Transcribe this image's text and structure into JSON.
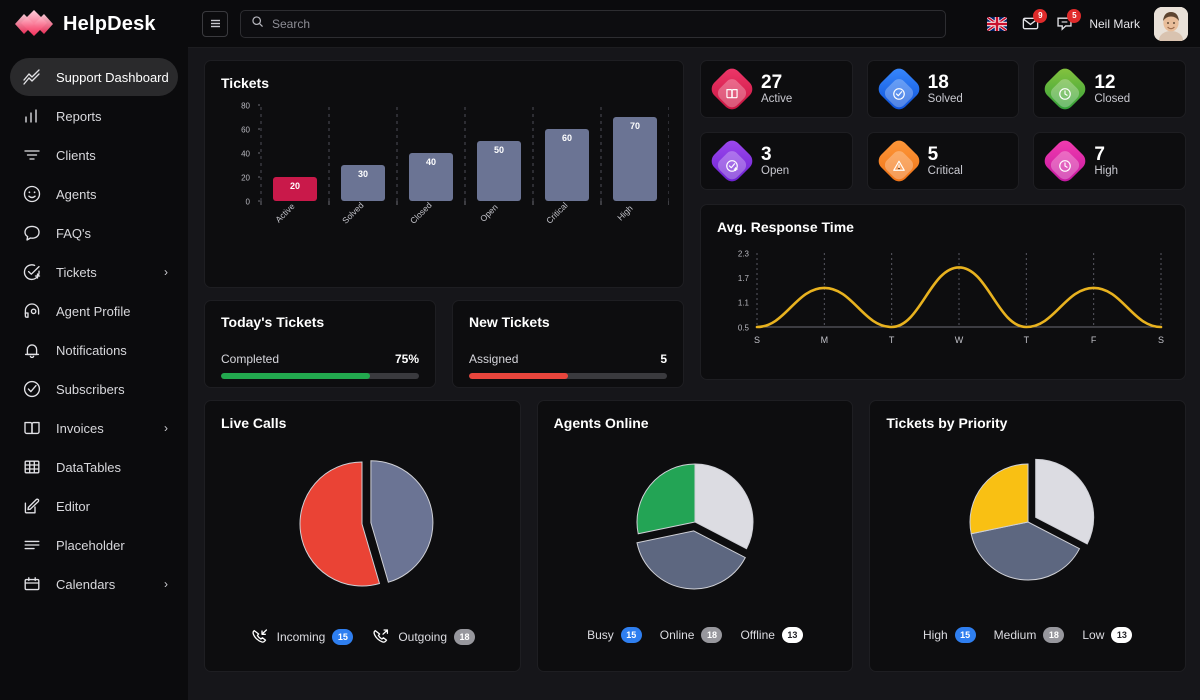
{
  "brand": {
    "name": "HelpDesk",
    "logo_icon": "diamond-cluster-logo"
  },
  "sidebar": {
    "items": [
      {
        "label": "Support Dashboard",
        "icon": "activity-chart-icon",
        "active": true,
        "caret": ""
      },
      {
        "label": "Reports",
        "icon": "bar-chart-icon",
        "active": false,
        "caret": ""
      },
      {
        "label": "Clients",
        "icon": "filter-icon",
        "active": false,
        "caret": ""
      },
      {
        "label": "Agents",
        "icon": "smiley-icon",
        "active": false,
        "caret": ""
      },
      {
        "label": "FAQ's",
        "icon": "chat-bubble-icon",
        "active": false,
        "caret": ""
      },
      {
        "label": "Tickets",
        "icon": "check-circle-plus-icon",
        "active": false,
        "caret": "›"
      },
      {
        "label": "Agent Profile",
        "icon": "headset-user-icon",
        "active": false,
        "caret": ""
      },
      {
        "label": "Notifications",
        "icon": "bell-icon",
        "active": false,
        "caret": ""
      },
      {
        "label": "Subscribers",
        "icon": "check-circle-icon",
        "active": false,
        "caret": ""
      },
      {
        "label": "Invoices",
        "icon": "book-icon",
        "active": false,
        "caret": "›"
      },
      {
        "label": "DataTables",
        "icon": "table-grid-icon",
        "active": false,
        "caret": ""
      },
      {
        "label": "Editor",
        "icon": "pencil-square-icon",
        "active": false,
        "caret": ""
      },
      {
        "label": "Placeholder",
        "icon": "lines-icon",
        "active": false,
        "caret": ""
      },
      {
        "label": "Calendars",
        "icon": "calendar-icon",
        "active": false,
        "caret": "›"
      }
    ]
  },
  "topbar": {
    "menu_icon": "hamburger-icon",
    "search": {
      "placeholder": "Search",
      "value": "",
      "icon": "search-icon"
    },
    "flag_icon": "uk-flag-icon",
    "mail": {
      "icon": "mail-icon",
      "badge": "9"
    },
    "chat": {
      "icon": "chat-icon",
      "badge": "5"
    },
    "user": {
      "name": "Neil Mark",
      "avatar_icon": "user-avatar"
    }
  },
  "tickets_card": {
    "title": "Tickets"
  },
  "stats": [
    {
      "value": "27",
      "label": "Active",
      "icon": "book-open-icon",
      "c1": "#f0396c",
      "c2": "#c7143f"
    },
    {
      "value": "18",
      "label": "Solved",
      "icon": "check-circle-icon",
      "c1": "#3a8bff",
      "c2": "#0c4fd6"
    },
    {
      "value": "12",
      "label": "Closed",
      "icon": "clock-icon",
      "c1": "#8bc53f",
      "c2": "#2e9f3a"
    },
    {
      "value": "3",
      "label": "Open",
      "icon": "check-clock-icon",
      "c1": "#a04bf0",
      "c2": "#6a1fd0"
    },
    {
      "value": "5",
      "label": "Critical",
      "icon": "warning-icon",
      "c1": "#ff9a3c",
      "c2": "#ef7115"
    },
    {
      "value": "7",
      "label": "High",
      "icon": "clock-icon",
      "c1": "#f53fb0",
      "c2": "#c215a0"
    }
  ],
  "response_card": {
    "title": "Avg. Response Time"
  },
  "todays_tickets": {
    "title": "Today's Tickets",
    "label": "Completed",
    "value": "75%",
    "percent": 75,
    "color": "#22a84e"
  },
  "new_tickets": {
    "title": "New Tickets",
    "label": "Assigned",
    "value": "5",
    "percent": 50,
    "color": "#e8453c"
  },
  "live_calls": {
    "title": "Live Calls",
    "legend": [
      {
        "label": "Incoming",
        "value": "15",
        "pill_bg": "#2f7ff0",
        "pill_fg": "#ffffff",
        "icon": "call-incoming-icon"
      },
      {
        "label": "Outgoing",
        "value": "18",
        "pill_bg": "#97979d",
        "pill_fg": "#ffffff",
        "icon": "call-outgoing-icon"
      }
    ]
  },
  "agents_online": {
    "title": "Agents Online",
    "legend": [
      {
        "label": "Busy",
        "value": "15",
        "pill_bg": "#2f7ff0",
        "pill_fg": "#ffffff"
      },
      {
        "label": "Online",
        "value": "18",
        "pill_bg": "#97979d",
        "pill_fg": "#ffffff"
      },
      {
        "label": "Offline",
        "value": "13",
        "pill_bg": "#ffffff",
        "pill_fg": "#222228"
      }
    ]
  },
  "tickets_priority": {
    "title": "Tickets by Priority",
    "legend": [
      {
        "label": "High",
        "value": "15",
        "pill_bg": "#2f7ff0",
        "pill_fg": "#ffffff"
      },
      {
        "label": "Medium",
        "value": "18",
        "pill_bg": "#97979d",
        "pill_fg": "#ffffff"
      },
      {
        "label": "Low",
        "value": "13",
        "pill_bg": "#ffffff",
        "pill_fg": "#222228"
      }
    ]
  },
  "chart_data": [
    {
      "type": "bar",
      "title": "Tickets",
      "categories": [
        "Active",
        "Solved",
        "Closed",
        "Open",
        "Critical",
        "High"
      ],
      "values": [
        20,
        30,
        40,
        50,
        60,
        70
      ],
      "bar_colors": [
        "#c9194a",
        "#6b7494",
        "#6b7494",
        "#6b7494",
        "#6b7494",
        "#6b7494"
      ],
      "data_labels": [
        "20",
        "30",
        "40",
        "50",
        "60",
        "70"
      ],
      "yticks": [
        0,
        20,
        40,
        60,
        80
      ],
      "ylim": [
        0,
        80
      ],
      "xlabel": "",
      "ylabel": "",
      "grid": "vertical-dashed",
      "legend": "none"
    },
    {
      "type": "line",
      "title": "Avg. Response Time",
      "x": [
        "S",
        "M",
        "T",
        "W",
        "T",
        "F",
        "S"
      ],
      "series": [
        {
          "name": "Avg. Response Time",
          "values": [
            0.5,
            1.45,
            0.5,
            1.95,
            0.5,
            1.45,
            0.5
          ],
          "color": "#e8b21f"
        }
      ],
      "yticks": [
        0.5,
        1.1,
        1.7,
        2.3
      ],
      "ylim": [
        0.5,
        2.3
      ],
      "grid": "vertical-dotted",
      "legend": "none",
      "smooth": true
    },
    {
      "type": "pie",
      "title": "Live Calls",
      "labels": [
        "Incoming",
        "Outgoing"
      ],
      "values": [
        15,
        18
      ],
      "colors": [
        "#6b7494",
        "#ea4335"
      ],
      "exploded": [
        "Incoming"
      ]
    },
    {
      "type": "pie",
      "title": "Agents Online",
      "labels": [
        "Busy",
        "Online",
        "Offline"
      ],
      "values": [
        15,
        18,
        13
      ],
      "colors": [
        "#dcdce2",
        "#5d6780",
        "#23a455"
      ],
      "exploded": [
        "Online"
      ]
    },
    {
      "type": "pie",
      "title": "Tickets by Priority",
      "labels": [
        "High",
        "Medium",
        "Low"
      ],
      "values": [
        15,
        18,
        13
      ],
      "colors": [
        "#dcdce2",
        "#5d6780",
        "#f9c013"
      ],
      "exploded": [
        "High"
      ]
    }
  ]
}
